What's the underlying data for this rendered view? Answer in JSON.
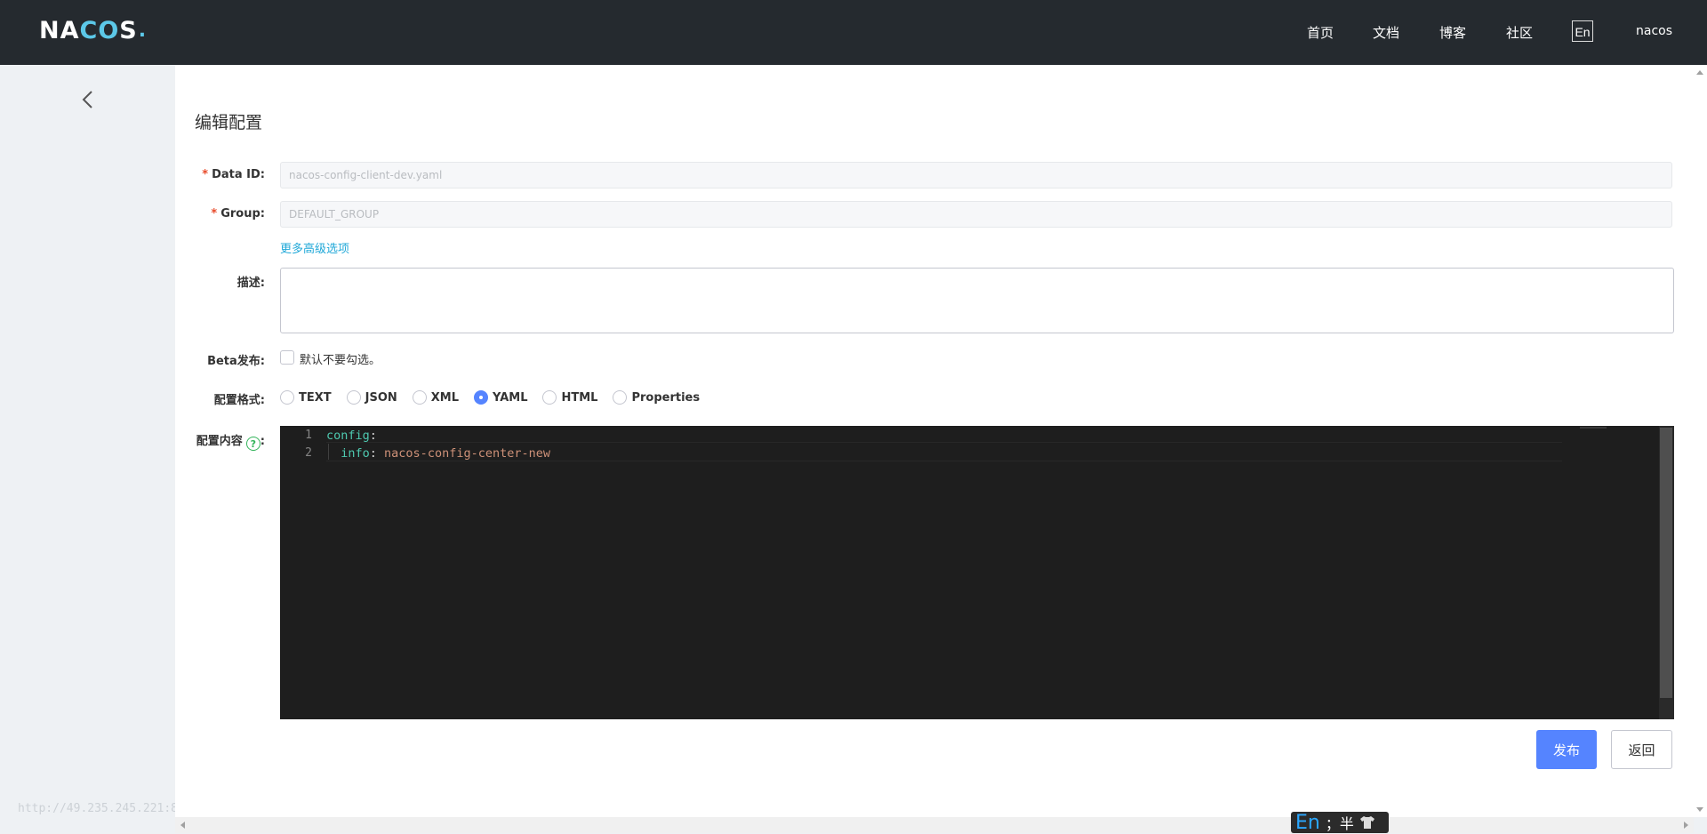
{
  "header": {
    "logo": {
      "text_a": "NA",
      "text_b": "CO",
      "text_c": "S",
      "dot": "."
    },
    "nav": [
      "首页",
      "文档",
      "博客",
      "社区"
    ],
    "lang_button": "En",
    "user": "nacos"
  },
  "sidebar": {
    "back_icon": "chevron-left-icon",
    "faint_url": "http://49.235.245.221:8"
  },
  "page": {
    "title": "编辑配置",
    "fields": {
      "data_id": {
        "label": "Data ID:",
        "value": "nacos-config-client-dev.yaml"
      },
      "group": {
        "label": "Group:",
        "value": "DEFAULT_GROUP"
      },
      "advanced_link": "更多高级选项",
      "description": {
        "label": "描述:",
        "value": ""
      },
      "beta": {
        "label": "Beta发布:",
        "hint": "默认不要勾选。"
      },
      "format": {
        "label": "配置格式:",
        "options": [
          "TEXT",
          "JSON",
          "XML",
          "YAML",
          "HTML",
          "Properties"
        ],
        "selected": "YAML"
      },
      "content": {
        "label": "配置内容",
        "help_icon": "?",
        "colon": ":",
        "lines": [
          {
            "num": "1",
            "key": "config",
            "sep": ":",
            "value": ""
          },
          {
            "num": "2",
            "key": "  info",
            "sep": ": ",
            "value": "nacos-config-center-new"
          }
        ]
      }
    },
    "buttons": {
      "publish": "发布",
      "back": "返回"
    }
  },
  "ime_bar": {
    "mode": "En",
    "status": "；半"
  }
}
